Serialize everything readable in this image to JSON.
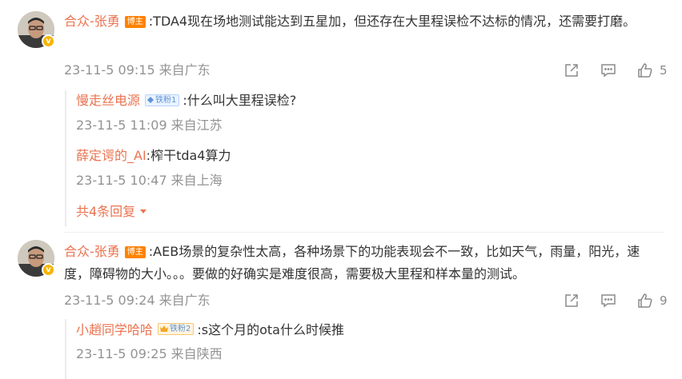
{
  "comments": [
    {
      "username": "合众-张勇",
      "badge": "博主",
      "text": ":TDA4现在场地测试能达到五星加，但还存在大里程误检不达标的情况，还需要打磨。",
      "time": "23-11-5 09:15",
      "location": "来自广东",
      "likes": "5",
      "replies": [
        {
          "username": "慢走丝电源",
          "fan_badge": "铁粉1",
          "text": ":什么叫大里程误检?",
          "time": "23-11-5 11:09",
          "location": "来自江苏"
        },
        {
          "username": "薛定谔的_AI",
          "text": ":榨干tda4算力",
          "time": "23-11-5 10:47",
          "location": "来自上海"
        }
      ],
      "more_replies": "共4条回复"
    },
    {
      "username": "合众-张勇",
      "badge": "博主",
      "text": ":AEB场景的复杂性太高，各种场景下的功能表现会不一致，比如天气，雨量，阳光，速度，障碍物的大小。。。要做的好确实是难度很高，需要极大里程和样本量的测试。",
      "time": "23-11-5 09:24",
      "location": "来自广东",
      "likes": "9",
      "replies": [
        {
          "username": "小趙同学哈哈",
          "fan_badge": "铁粉2",
          "text": ":s这个月的ota什么时候推",
          "time": "23-11-5 09:25",
          "location": "来自陕西"
        }
      ]
    }
  ],
  "colors": {
    "username": "#eb7350",
    "blogger_tag": "#ff8200",
    "fan_tag": "#5d93d8",
    "verified": "#f7b500",
    "meta": "#939393"
  },
  "icons": {
    "share": "share-icon",
    "comment": "comment-icon",
    "like": "like-icon",
    "more_arrow": "caret-down-icon"
  }
}
